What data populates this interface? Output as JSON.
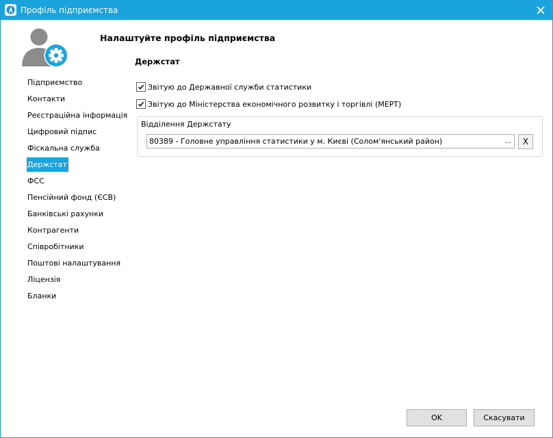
{
  "window": {
    "title": "Профіль підприємства",
    "icons": {
      "app": "app-logo-icon",
      "close": "close-icon"
    }
  },
  "header": {
    "title": "Налаштуйте профіль підприємства",
    "logo_icon": "user-gear-icon"
  },
  "sidebar": {
    "selected_index": 5,
    "items": [
      {
        "label": "Підприємство"
      },
      {
        "label": "Контакти"
      },
      {
        "label": "Реєстраційна інформація"
      },
      {
        "label": "Цифровий підпис"
      },
      {
        "label": "Фіскальна служба"
      },
      {
        "label": "Держстат"
      },
      {
        "label": "ФСС"
      },
      {
        "label": "Пенсійний фонд (ЄСВ)"
      },
      {
        "label": "Банківські рахунки"
      },
      {
        "label": "Контрагенти"
      },
      {
        "label": "Співробітники"
      },
      {
        "label": "Поштові налаштування"
      },
      {
        "label": "Ліцензія"
      },
      {
        "label": "Бланки"
      }
    ]
  },
  "section": {
    "title": "Держстат",
    "checkbox_state_stats": {
      "label": "Звітую до Державної служби статистики",
      "checked": true
    },
    "checkbox_mert": {
      "label": "Звітую до Міністерства економічного розвитку і торгівлі (МЕРТ)",
      "checked": true
    },
    "group": {
      "label": "Відділення Держстату",
      "field_value": "80389 - Головне управління статистики у м. Києві (Солом'янський район)",
      "browse_label": "...",
      "clear_label": "X"
    }
  },
  "footer": {
    "ok_label": "OK",
    "cancel_label": "Скасувати"
  },
  "colors": {
    "accent": "#19a4dd",
    "selection": "#19a4dd",
    "logo_gray": "#8c8c8c"
  }
}
